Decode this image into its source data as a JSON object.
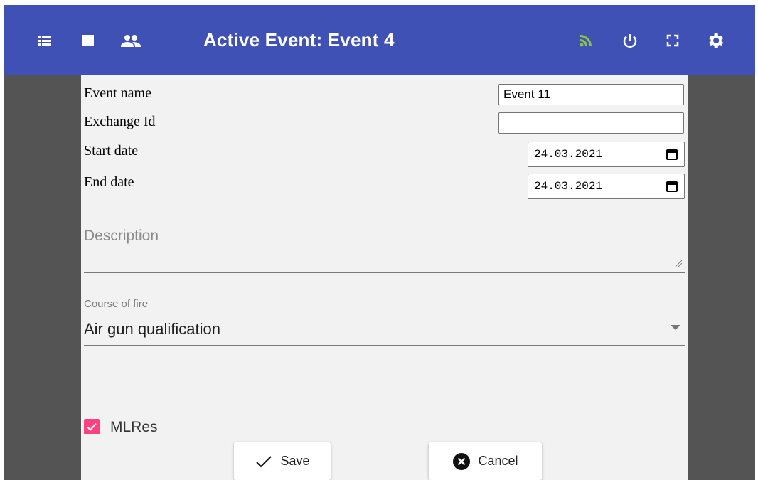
{
  "appbar": {
    "title": "Active Event: Event 4",
    "left_icons": [
      "list-icon",
      "stop-icon",
      "people-icon"
    ],
    "right_icons": [
      "rss-icon",
      "power-icon",
      "fullscreen-icon",
      "gear-icon"
    ],
    "colors": {
      "bar": "#3f51b5",
      "rss": "#8bc34a",
      "icon": "#ffffff"
    }
  },
  "form": {
    "event_name_label": "Event name",
    "event_name_value": "Event 11",
    "exchange_id_label": "Exchange Id",
    "exchange_id_value": "",
    "start_date_label": "Start date",
    "start_date_value": "24.03.2021",
    "end_date_label": "End date",
    "end_date_value": "24.03.2021",
    "description_label": "Description",
    "course_of_fire_label": "Course of fire",
    "course_of_fire_value": "Air gun qualification",
    "mlres_label": "MLRes",
    "mlres_checked": true
  },
  "buttons": {
    "save": "Save",
    "cancel": "Cancel"
  },
  "colors": {
    "panel": "#f2f2f2",
    "side": "#545454",
    "checkbox": "#ff4081"
  }
}
